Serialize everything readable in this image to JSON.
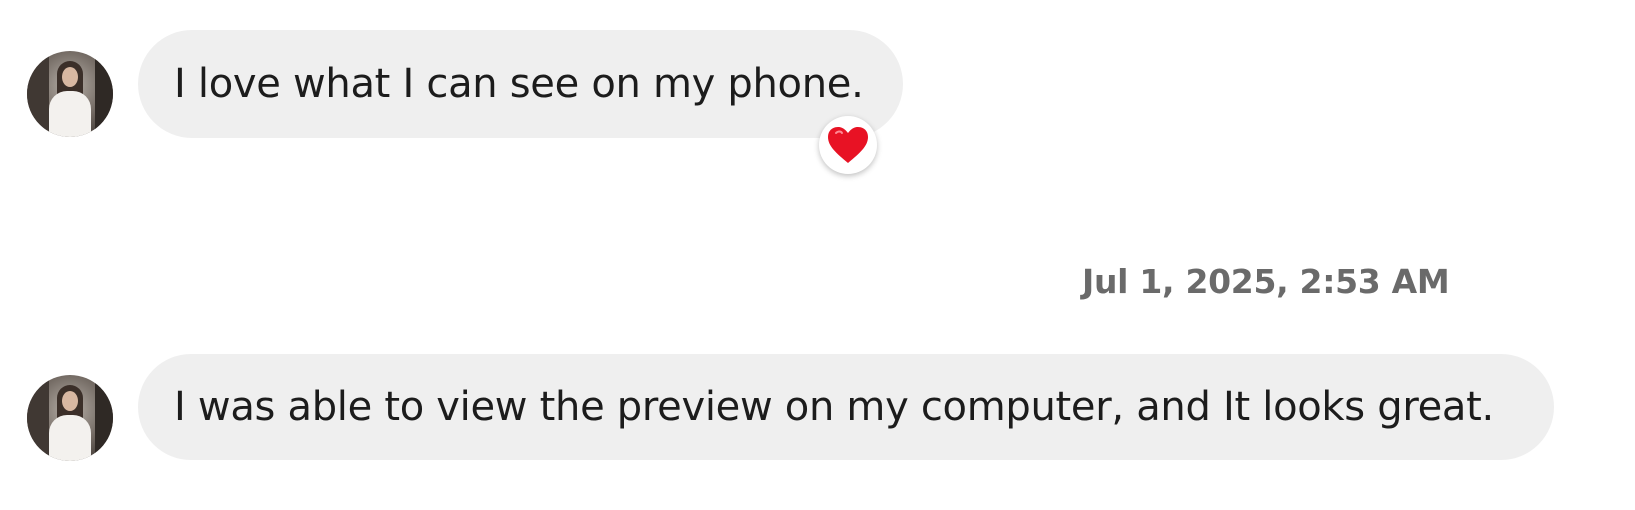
{
  "messages": [
    {
      "text": "I love what I can see on my phone.",
      "reaction": "heart-reaction"
    },
    {
      "text": "I was able to view the preview on my computer, and It looks great."
    }
  ],
  "timestamp": "Jul 1, 2025, 2:53 AM",
  "colors": {
    "bubble": "#efefef",
    "text": "#1c1c1c",
    "timestamp": "#6a6a6a",
    "reaction_heart": "#e81224"
  },
  "icons": {
    "avatar": "avatar",
    "reaction": "heart-icon"
  }
}
